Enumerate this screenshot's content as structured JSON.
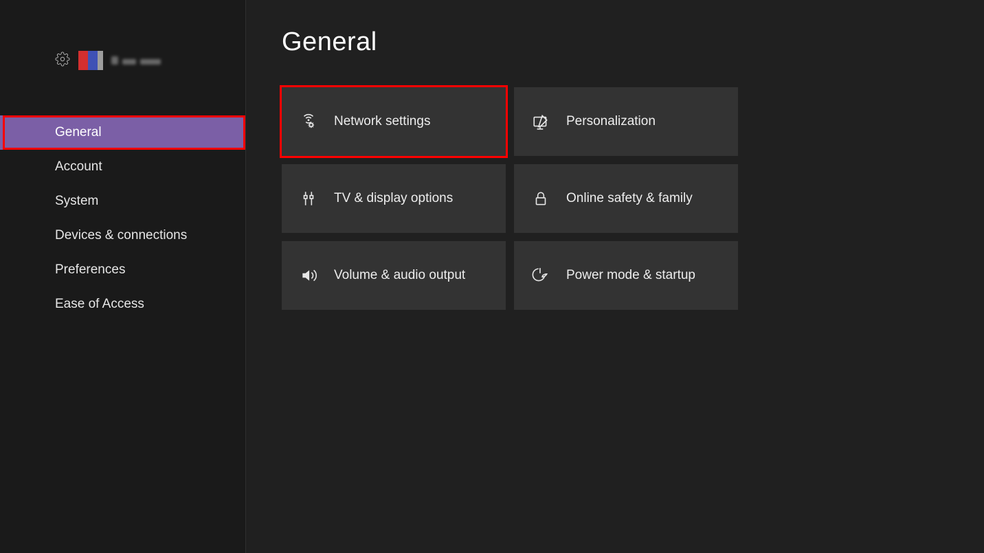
{
  "sidebar": {
    "items": [
      {
        "label": "General",
        "selected": true,
        "highlighted": true
      },
      {
        "label": "Account",
        "selected": false,
        "highlighted": false
      },
      {
        "label": "System",
        "selected": false,
        "highlighted": false
      },
      {
        "label": "Devices & connections",
        "selected": false,
        "highlighted": false
      },
      {
        "label": "Preferences",
        "selected": false,
        "highlighted": false
      },
      {
        "label": "Ease of Access",
        "selected": false,
        "highlighted": false
      }
    ]
  },
  "main": {
    "title": "General",
    "tiles": [
      {
        "label": "Network settings",
        "icon": "network-icon",
        "highlighted": true
      },
      {
        "label": "Personalization",
        "icon": "personalize-icon",
        "highlighted": false
      },
      {
        "label": "TV & display options",
        "icon": "display-cable-icon",
        "highlighted": false
      },
      {
        "label": "Online safety & family",
        "icon": "lock-icon",
        "highlighted": false
      },
      {
        "label": "Volume & audio output",
        "icon": "volume-icon",
        "highlighted": false
      },
      {
        "label": "Power mode & startup",
        "icon": "power-eco-icon",
        "highlighted": false
      }
    ]
  },
  "colors": {
    "selected_nav_bg": "#7b5fa6",
    "tile_bg": "#333333",
    "highlight_border": "#ff0000",
    "sidebar_bg": "#1a1a1a",
    "main_bg": "#202020"
  }
}
